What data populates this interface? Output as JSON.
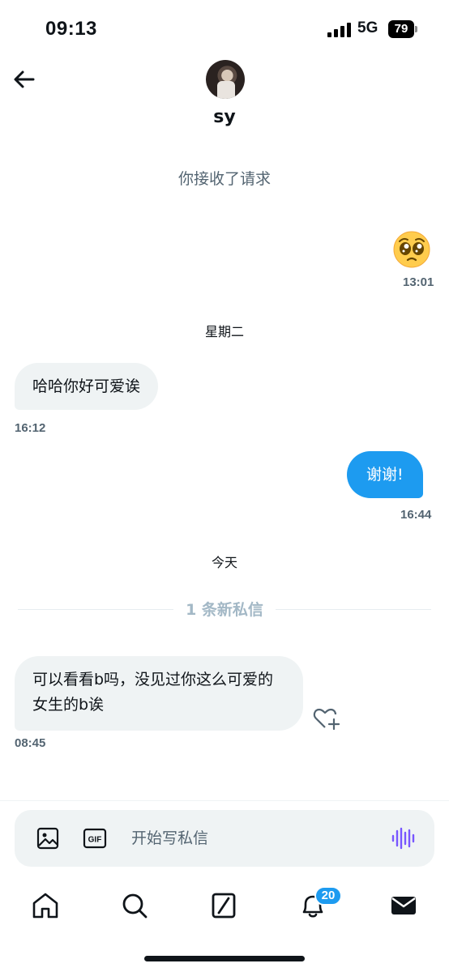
{
  "status_bar": {
    "time": "09:13",
    "network": "5G",
    "battery": "79"
  },
  "header": {
    "username": "sy"
  },
  "conversation": {
    "system_note": "你接收了请求",
    "emoji_message": {
      "emoji": "pleading-face",
      "time": "13:01"
    },
    "day1": "星期二",
    "msg1": {
      "text": "哈哈你好可爱诶",
      "time": "16:12"
    },
    "msg2": {
      "text": "谢谢!",
      "time": "16:44"
    },
    "day2": "今天",
    "new_label": "1 条新私信",
    "msg3": {
      "text": "可以看看b吗，没见过你这么可爱的女生的b诶",
      "time": "08:45"
    }
  },
  "composer": {
    "placeholder": "开始写私信",
    "gif_label": "GIF"
  },
  "tabbar": {
    "notifications_badge": "20"
  },
  "colors": {
    "accent": "#1d9bf0",
    "bubble_in": "#eff3f4",
    "muted": "#536471",
    "voice": "#7856ff"
  }
}
